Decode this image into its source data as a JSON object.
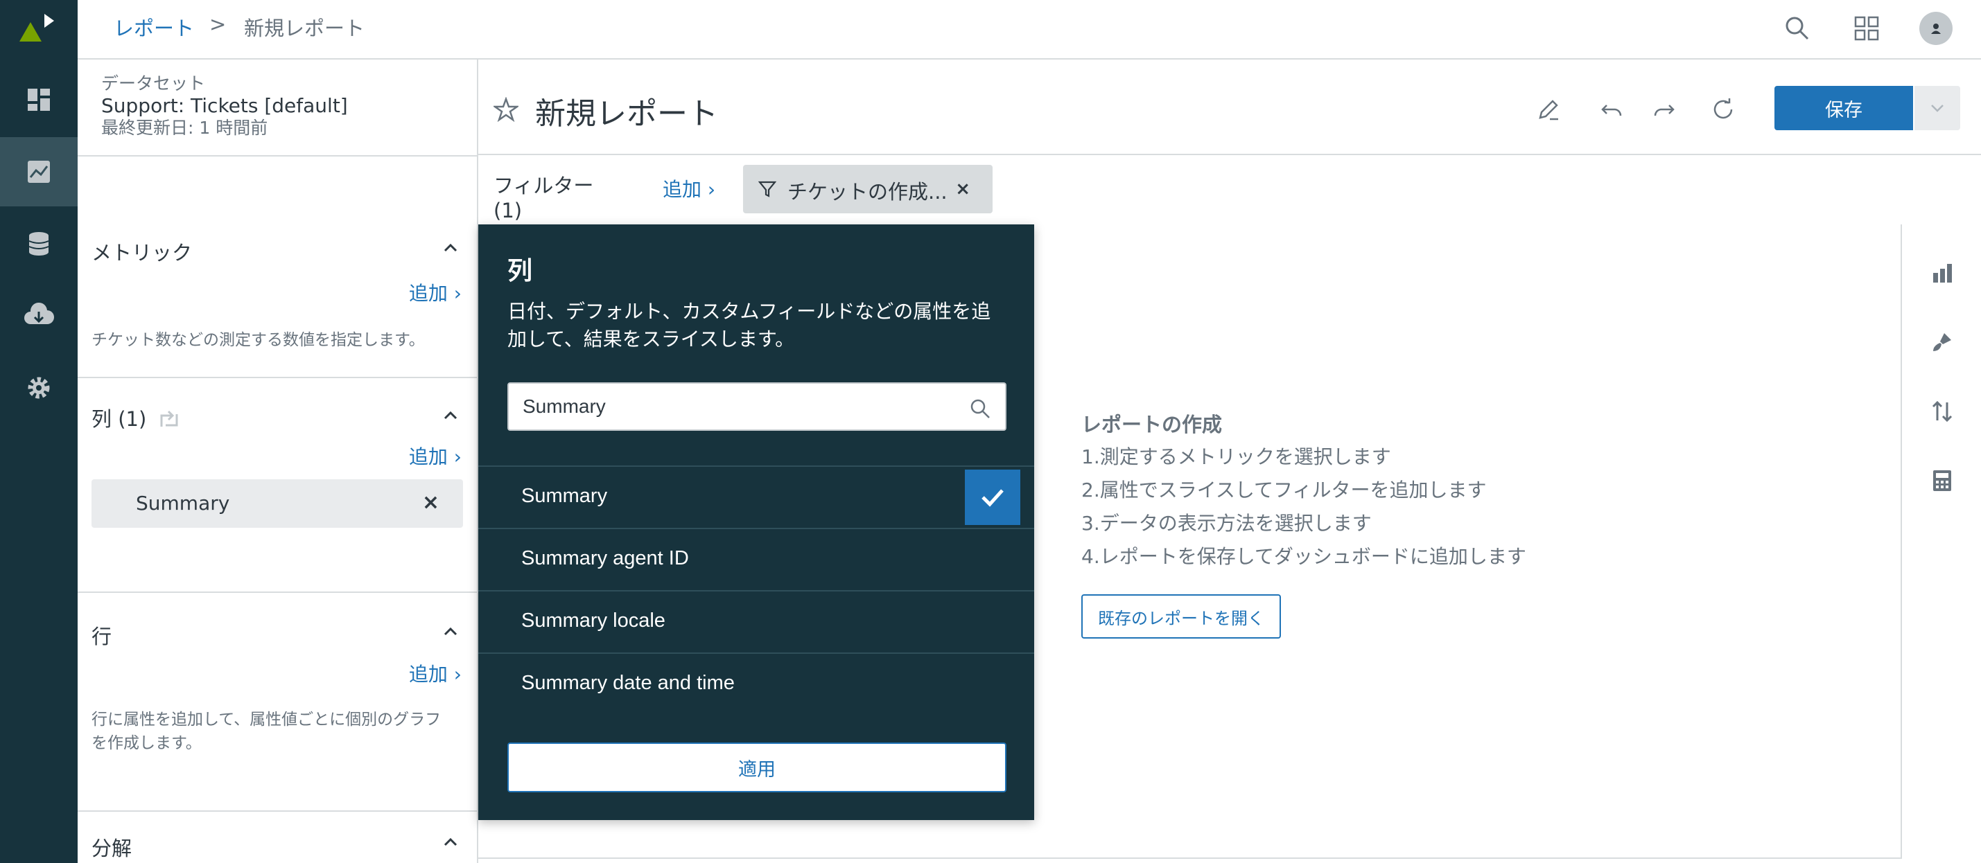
{
  "colors": {
    "nav_bg": "#17333d",
    "accent": "#1f73b7",
    "chip_bg": "#d8dcde",
    "muted": "#68737d"
  },
  "nav": {
    "items": [
      {
        "icon": "dashboard-icon"
      },
      {
        "icon": "reports-chart-icon",
        "active": true
      },
      {
        "icon": "database-icon"
      },
      {
        "icon": "download-cloud-icon"
      },
      {
        "icon": "gear-icon"
      }
    ]
  },
  "breadcrumb": {
    "parent": "レポート",
    "separator": ">",
    "current": "新規レポート"
  },
  "dataset": {
    "caption": "データセット",
    "name": "Support: Tickets [default]",
    "updated": "最終更新日: 1 時間前"
  },
  "sections": {
    "metrics": {
      "title": "メトリック",
      "add": "追加 ›",
      "description": "チケット数などの測定する数値を指定します。"
    },
    "columns": {
      "title": "列 (1)",
      "add": "追加 ›",
      "pill": "Summary"
    },
    "rows": {
      "title": "行",
      "add": "追加 ›",
      "description": "行に属性を追加して、属性値ごとに個別のグラフを作成します。"
    },
    "explode": {
      "title": "分解"
    }
  },
  "header": {
    "title": "新規レポート",
    "save": "保存"
  },
  "filter": {
    "label": "フィルター (1)",
    "add": "追加 ›",
    "chip": "チケットの作成..."
  },
  "popover": {
    "title": "列",
    "description": "日付、デフォルト、カスタムフィールドなどの属性を追加して、結果をスライスします。",
    "search_value": "Summary",
    "options": [
      {
        "label": "Summary",
        "selected": true
      },
      {
        "label": "Summary agent ID",
        "selected": false
      },
      {
        "label": "Summary locale",
        "selected": false
      },
      {
        "label": "Summary date and time",
        "selected": false
      }
    ],
    "apply": "適用"
  },
  "guide": {
    "title": "レポートの作成",
    "steps": [
      "1.測定するメトリックを選択します",
      "2.属性でスライスしてフィルターを追加します",
      "3.データの表示方法を選択します",
      "4.レポートを保存してダッシュボードに追加します"
    ],
    "open_button": "既存のレポートを開く"
  },
  "right_tools": [
    "bar-chart-icon",
    "paintbrush-icon",
    "sort-icon",
    "calculator-icon"
  ]
}
